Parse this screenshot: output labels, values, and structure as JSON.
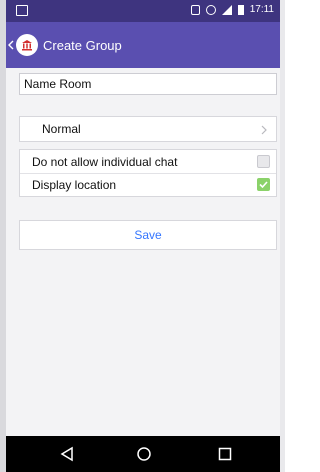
{
  "status_bar": {
    "time": "17:11",
    "icons": [
      "screenshot-icon",
      "vibrate-icon",
      "alarm-icon",
      "signal-icon",
      "battery-icon"
    ]
  },
  "header": {
    "title": "Create Group",
    "logo_icon": "library-building-icon",
    "back_icon": "chevron-left-icon",
    "background": "#5a4fb0",
    "statusbar_color": "#3e347f"
  },
  "form": {
    "name_field": {
      "value": "Name Room",
      "placeholder": ""
    },
    "type_selector": {
      "label": "Normal",
      "icon": "chevron-right-icon"
    },
    "settings": [
      {
        "label": "Do not allow individual chat",
        "checked": false
      },
      {
        "label": "Display location",
        "checked": true
      }
    ],
    "save_label": "Save"
  },
  "colors": {
    "accent": "#3576ff",
    "checkbox_on": "#8bd26a",
    "checkbox_off": "#e8e8eb"
  },
  "nav": {
    "buttons": [
      "back-triangle-icon",
      "home-circle-icon",
      "recent-square-icon"
    ]
  }
}
